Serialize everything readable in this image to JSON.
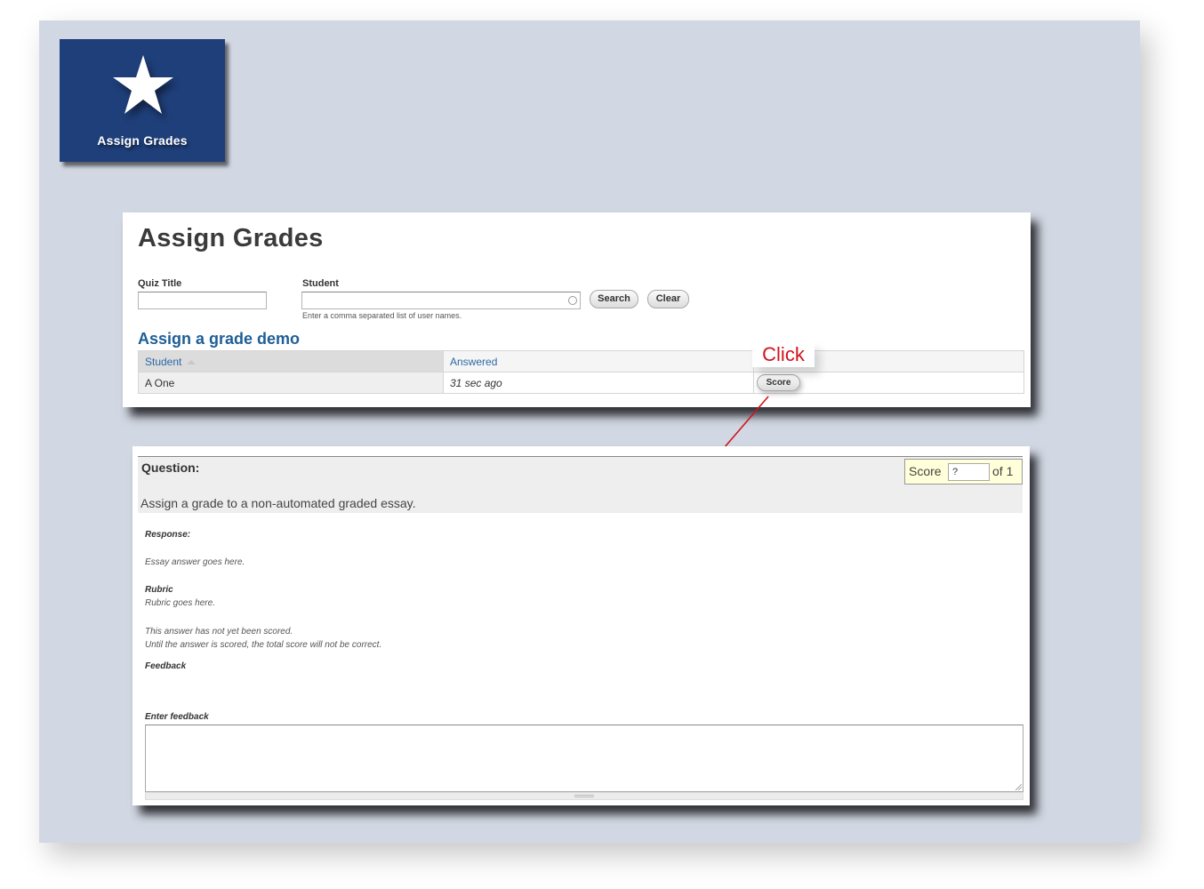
{
  "tile": {
    "icon": "star-icon",
    "label": "Assign Grades",
    "color": "#1f3f7a"
  },
  "search_card": {
    "title": "Assign Grades",
    "quiz_title": {
      "label": "Quiz Title",
      "value": ""
    },
    "student": {
      "label": "Student",
      "value": "",
      "hint": "Enter a comma separated list of user names."
    },
    "search_button": "Search",
    "clear_button": "Clear",
    "section_title": "Assign a grade demo",
    "table": {
      "columns": [
        "Student",
        "Answered",
        ""
      ],
      "rows": [
        {
          "student": "A One",
          "answered_num": "31",
          "answered_rest": " sec ago",
          "action": "Score"
        }
      ]
    }
  },
  "annotation": {
    "callout": "Click",
    "color": "#d0141c"
  },
  "grading_card": {
    "question_label": "Question:",
    "question_text": "Assign a grade to a non-automated graded essay.",
    "score": {
      "label": "Score",
      "value": "?",
      "of": "of 1"
    },
    "response_label": "Response:",
    "response_text": "Essay answer goes here.",
    "rubric_label": "Rubric",
    "rubric_text": "Rubric goes here.",
    "not_scored_1": "This answer has not yet been scored.",
    "not_scored_2": "Until the answer is scored, the total score will not be correct.",
    "feedback_label": "Feedback",
    "enter_feedback_label": "Enter feedback",
    "feedback_value": ""
  }
}
